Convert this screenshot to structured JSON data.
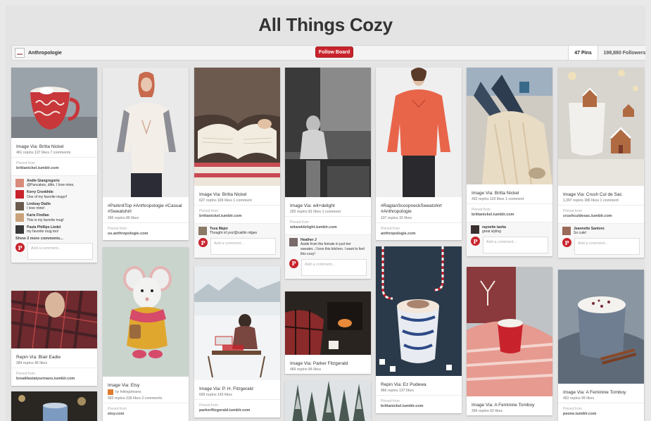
{
  "board": {
    "title": "All Things Cozy",
    "owner": "Anthropologie",
    "follow_label": "Follow Board",
    "pins_count": "47 Pins",
    "followers_count": "198,880 Followers"
  },
  "common": {
    "pinned_from": "Pinned from",
    "add_comment": "Add a comment..."
  },
  "colors": {
    "pinterest_red": "#c8232c",
    "bar_bg": "#f4f4f4"
  },
  "pins": [
    {
      "desc": "Image Via: Britta Nickel",
      "stats": "461 repins   137 likes   7 comments",
      "source": "brittanickel.tumblr.com",
      "comments": [
        {
          "name": "Andie Giangregorio",
          "text": "@Pancakes, ditto. I love mine."
        },
        {
          "name": "Kerry Cronkhite",
          "text": "One of my favorite mugs!!"
        },
        {
          "name": "Lindsay Diallo",
          "text": "I love mine!"
        },
        {
          "name": "Karis Findlan",
          "text": "This is my favorite mug!"
        },
        {
          "name": "Paula Phillips Liedel",
          "text": "my favorite mug too!"
        }
      ],
      "more": "Show 2 more comments..."
    },
    {
      "desc": "Repin Via: Blair Eadie",
      "stats": "384 repins   46 likes",
      "source": "breakfastatyurmans.tumblr.com"
    },
    {
      "desc": "#ParknitTop #Anthropologie #Casual #Sweatshirt",
      "stats": "390 repins   80 likes",
      "source": "us.anthropologie.com"
    },
    {
      "desc": "Image Via: Etsy",
      "via": "by feltingdreams",
      "stats": "583 repins   218 likes   2 comments",
      "source": "etsy.com"
    },
    {
      "desc": "Image Via: Britta Nickel",
      "stats": "627 repins   169 likes   1 comment",
      "source": "brittanickel.tumblr.com",
      "comments": [
        {
          "name": "Tova Major",
          "text": "Thought of you!@caitlin nilges"
        }
      ]
    },
    {
      "desc": "Image Via: P. H. Fitzgerald",
      "stats": "609 repins   143 likes",
      "source": "parkerfitzgerald.tumblr.com"
    },
    {
      "desc": "Image Via: wit+delight",
      "stats": "293 repins   81 likes   1 comment",
      "source": "witanddelight.tumblr.com",
      "comments": [
        {
          "name": "Heather J",
          "text": "Aside from the female in just her sweater...I love this kitchen. I want to feel this cozy!"
        }
      ]
    },
    {
      "desc": "Image Via: Parker Fitzgerald",
      "stats": "469 repins   84 likes"
    },
    {
      "desc": "#RaglanScoopneckSweatshirt #Anthropologie",
      "stats": "137 repins   32 likes",
      "source": "anthropologie.com"
    },
    {
      "desc": "Repin Via: Ez Pudewa",
      "stats": "966 repins   137 likes",
      "source": "brittanickel.tumblr.com"
    },
    {
      "desc": "Image Via: Britta Nickel",
      "stats": "432 repins   119 likes   1 comment",
      "source": "brittanickel.tumblr.com",
      "comments": [
        {
          "name": "raynette tasha",
          "text": "great styling"
        }
      ]
    },
    {
      "desc": "Image Via: A Feminine Tomboy",
      "stats": "306 repins   63 likes"
    },
    {
      "desc": "Image Via: Crush Cul de Sac",
      "stats": "1,397 repins   385 likes   1 comment",
      "source": "crushculdesac.tumblr.com",
      "comments": [
        {
          "name": "Jeannette Santoro",
          "text": "So cute!"
        }
      ]
    },
    {
      "desc": "Image Via: A Feminine Tomboy",
      "stats": "453 repins   99 likes",
      "source": "peone.tumblr.com"
    }
  ]
}
